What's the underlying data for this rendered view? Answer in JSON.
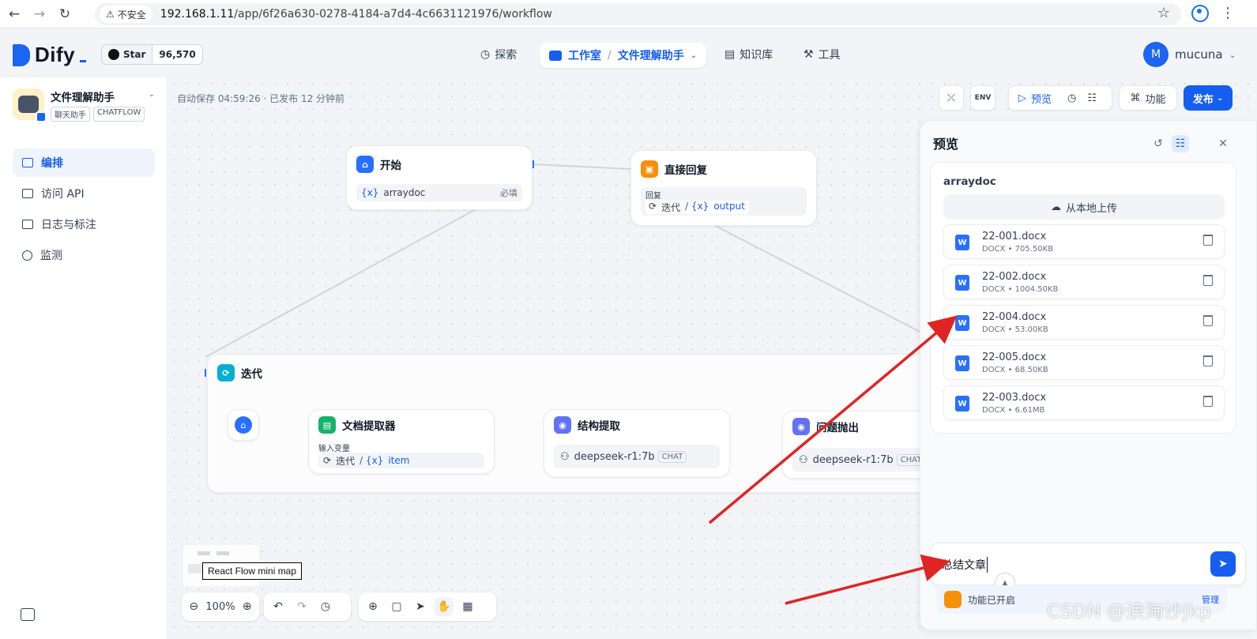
{
  "browser": {
    "insecure_label": "不安全",
    "url_host": "192.168.1.11",
    "url_path": "/app/6f26a630-0278-4184-a7d4-4c6631121976/workflow",
    "icons": [
      "back-icon",
      "forward-icon",
      "reload-icon",
      "warning-icon",
      "star-icon",
      "profile-icon",
      "menu-icon"
    ]
  },
  "header": {
    "logo_text": "Dify",
    "github_star_label": "Star",
    "github_star_count": "96,570",
    "nav": {
      "explore": "探索",
      "studio": "工作室",
      "app_switch": "文件理解助手",
      "knowledge": "知识库",
      "tools": "工具"
    },
    "user_initial": "M",
    "user_name": "mucuna"
  },
  "sidebar": {
    "app_name": "文件理解助手",
    "app_tags": [
      "聊天助手",
      "CHATFLOW"
    ],
    "items": [
      {
        "label": "编排",
        "active": true,
        "icon": "layout-icon"
      },
      {
        "label": "访问 API",
        "active": false,
        "icon": "terminal-icon"
      },
      {
        "label": "日志与标注",
        "active": false,
        "icon": "log-icon"
      },
      {
        "label": "监测",
        "active": false,
        "icon": "monitor-icon"
      }
    ]
  },
  "canvas": {
    "autosave": "自动保存 04:59:26 · 已发布 12 分钟前",
    "toolbar": {
      "env": "ENV",
      "preview": "预览",
      "features": "功能",
      "publish": "发布"
    },
    "nodes": {
      "start": {
        "title": "开始",
        "var": "arraydoc",
        "required": "必填"
      },
      "answer": {
        "title": "直接回复",
        "label": "回复",
        "iter": "迭代",
        "var": "output"
      },
      "iteration": {
        "title": "迭代"
      },
      "doc_extractor": {
        "title": "文档提取器",
        "label": "输入变量",
        "iter": "迭代",
        "var": "item"
      },
      "struct_extract": {
        "title": "结构提取",
        "model": "deepseek-r1:7b",
        "mode": "CHAT"
      },
      "question": {
        "title": "问题抛出",
        "model": "deepseek-r1:7b",
        "mode": "CHAT"
      }
    },
    "minimap_tooltip": "React Flow mini map",
    "zoom": "100%"
  },
  "preview": {
    "title": "预览",
    "field_label": "arraydoc",
    "upload_label": "从本地上传",
    "files": [
      {
        "name": "22-001.docx",
        "meta": "DOCX • 705.50KB"
      },
      {
        "name": "22-002.docx",
        "meta": "DOCX • 1004.50KB"
      },
      {
        "name": "22-004.docx",
        "meta": "DOCX • 53.00KB"
      },
      {
        "name": "22-005.docx",
        "meta": "DOCX • 68.50KB"
      },
      {
        "name": "22-003.docx",
        "meta": "DOCX • 6.61MB"
      }
    ],
    "chat_text": "总结文章",
    "features_on": "功能已开启",
    "manage": "管理"
  },
  "watermark": "CSDN @浪淘沙jkp",
  "colors": {
    "accent": "#155eef",
    "annotation_arrow": "#e02424"
  }
}
